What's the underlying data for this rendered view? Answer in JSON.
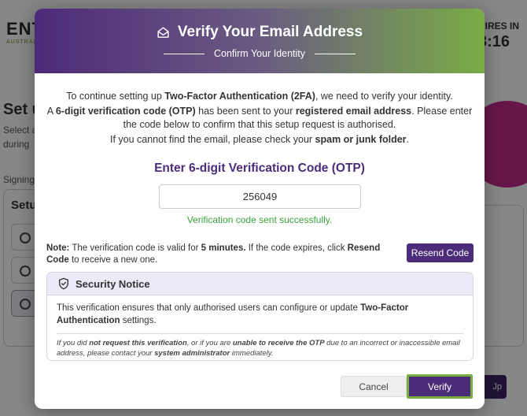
{
  "background": {
    "logo": "ENT",
    "logo_sub": "AUSTRAL",
    "expires_label": "PIRES IN",
    "timer": "3:16",
    "headline": "Set u",
    "text1": "Select a",
    "text2": "during",
    "text3": "Signing",
    "panel_title": "Setu",
    "setup_button_fragment": "Jp"
  },
  "modal": {
    "title": "Verify Your Email Address",
    "subtitle": "Confirm Your Identity",
    "intro": {
      "line1_pre": "To continue setting up ",
      "line1_bold": "Two-Factor Authentication (2FA)",
      "line1_post": ", we need to verify your identity.",
      "line2_pre": "A ",
      "line2_bold": "6-digit verification code (OTP)",
      "line2_mid": " has been sent to your ",
      "line2_bold2": "registered email address",
      "line2_post": ". Please enter the code below to confirm that this setup request is authorised.",
      "line3_pre": "If you cannot find the email, please check your ",
      "line3_bold": "spam or junk folder",
      "line3_post": "."
    },
    "otp_heading": "Enter 6-digit Verification Code (OTP)",
    "otp_value": "256049",
    "otp_status": "Verification code sent successfully.",
    "note": {
      "label": "Note:",
      "text1": " The verification code is valid for ",
      "bold": "5 minutes.",
      "text2": " If the code expires, click ",
      "bold2": "Resend Code",
      "text3": " to receive a new one."
    },
    "resend_label": "Resend Code",
    "security": {
      "title": "Security Notice",
      "body_pre": "This verification ensures that only authorised users can configure or update ",
      "body_bold": "Two-Factor Authentication",
      "body_post": " settings.",
      "small_pre": "If you did ",
      "small_bold1": "not request this verification",
      "small_mid": ", or if you are ",
      "small_bold2": "unable to receive the OTP",
      "small_mid2": " due to an incorrect or inaccessible email address, please contact your ",
      "small_bold3": "system administrator",
      "small_post": " immediately."
    },
    "cancel_label": "Cancel",
    "verify_label": "Verify"
  },
  "colors": {
    "brand_purple": "#4a2c78",
    "brand_green": "#79ac45",
    "success": "#3aa13a"
  }
}
